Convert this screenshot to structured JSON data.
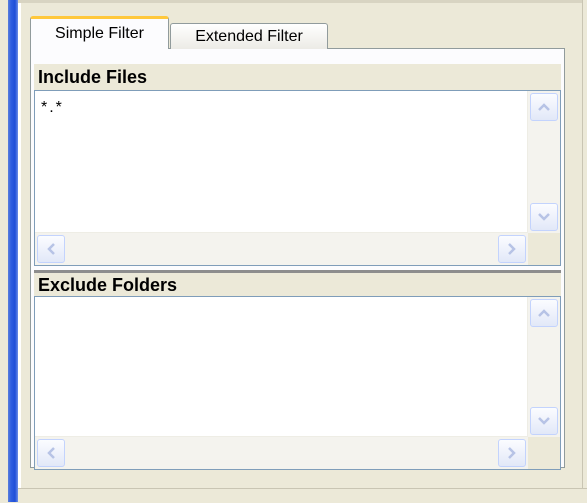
{
  "tabs": [
    {
      "label": "Simple Filter",
      "selected": true
    },
    {
      "label": "Extended Filter",
      "selected": false
    }
  ],
  "include_files": {
    "title": "Include Files",
    "items": [
      "*.*"
    ]
  },
  "exclude_folders": {
    "title": "Exclude Folders",
    "items": []
  },
  "colors": {
    "tab_accent": "#ffc83c",
    "sidebar_blue": "#2f5fe0",
    "panel_bg": "#ece9d8"
  },
  "icons": {
    "scroll_up": "chevron-up-icon",
    "scroll_down": "chevron-down-icon",
    "scroll_left": "chevron-left-icon",
    "scroll_right": "chevron-right-icon"
  }
}
